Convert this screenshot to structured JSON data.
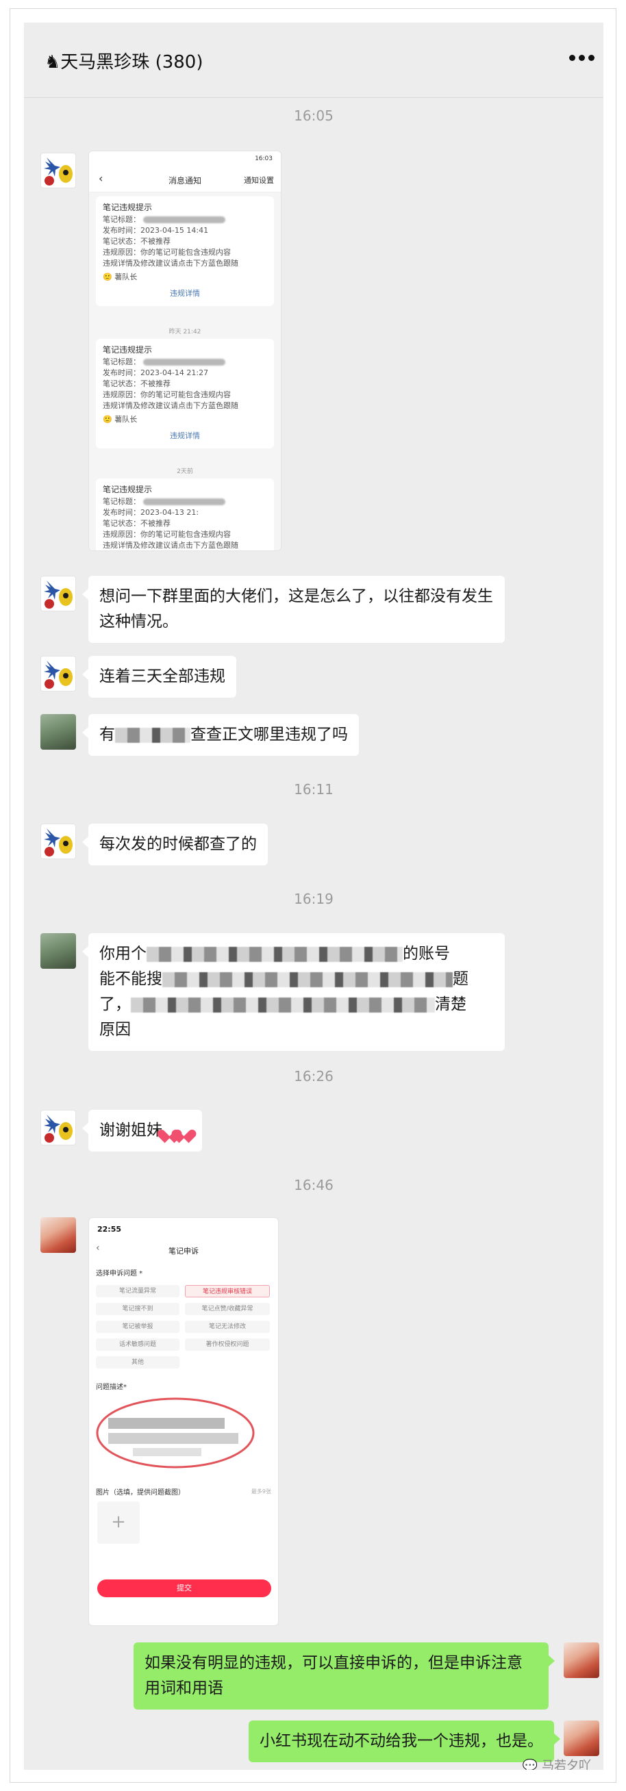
{
  "header": {
    "title": "♞天马黑珍珠 (380)",
    "more_icon": "more-icon"
  },
  "timestamps": [
    "16:05",
    "16:11",
    "16:19",
    "16:26",
    "16:46"
  ],
  "notice_screenshot": {
    "status_time": "16:03",
    "nav_title": "消息通知",
    "nav_action": "通知设置",
    "cards": [
      {
        "title": "笔记违规提示",
        "lines": [
          "笔记标题：",
          "发布时间：2023-04-15 14:41",
          "笔记状态：不被推荐",
          "违规原因：你的笔记可能包含违规内容",
          "违规详情及修改建议请点击下方蓝色跟随"
        ],
        "sender": "薯队长",
        "link": "违规详情"
      },
      {
        "title": "笔记违规提示",
        "lines": [
          "笔记标题：",
          "发布时间：2023-04-14 21:27",
          "笔记状态：不被推荐",
          "违规原因：你的笔记可能包含违规内容",
          "违规详情及修改建议请点击下方蓝色跟随"
        ],
        "sender": "薯队长",
        "link": "违规详情"
      },
      {
        "title": "笔记违规提示",
        "lines": [
          "笔记标题：",
          "发布时间：2023-04-13 21:",
          "笔记状态：不被推荐",
          "违规原因：你的笔记可能包含违规内容",
          "违规详情及修改建议请点击下方蓝色跟随"
        ]
      }
    ],
    "dividers": [
      "昨天 21:42",
      "2天前"
    ]
  },
  "messages": {
    "m1": "想问一下群里面的大佬们，这是怎么了，以往都没有发生这种情况。",
    "m2": "连着三天全部违规",
    "m3_pre": "有",
    "m3_post": "查查正文哪里违规了吗",
    "m4": "每次发的时候都查了的",
    "m5_l1_pre": "你用个",
    "m5_l1_post": "的账号",
    "m5_l2_pre": "能不能搜",
    "m5_l2_post": "题",
    "m5_l3_pre": "了，",
    "m5_l3_post": "清楚",
    "m5_l4": "原因",
    "m6": "谢谢姐妹",
    "m8": "如果没有明显的违规，可以直接申诉的，但是申诉注意用词和用语",
    "m9": "小红书现在动不动给我一个违规，也是。"
  },
  "appeal_screenshot": {
    "status_time": "22:55",
    "nav_title": "笔记申诉",
    "section_label": "选择申诉问题 *",
    "options": [
      "笔记流量异常",
      "笔记违规审核错误",
      "笔记搜不到",
      "笔记点赞/收藏异常",
      "笔记被举报",
      "笔记无法修改",
      "话术敏感问题",
      "著作权侵权问题",
      "其他"
    ],
    "selected_option": "笔记违规审核错误",
    "desc_label": "问题描述*",
    "image_label": "图片（选填，提供问题截图）",
    "image_count": "最多9张",
    "submit_label": "提交"
  },
  "watermark": "马若夕吖"
}
